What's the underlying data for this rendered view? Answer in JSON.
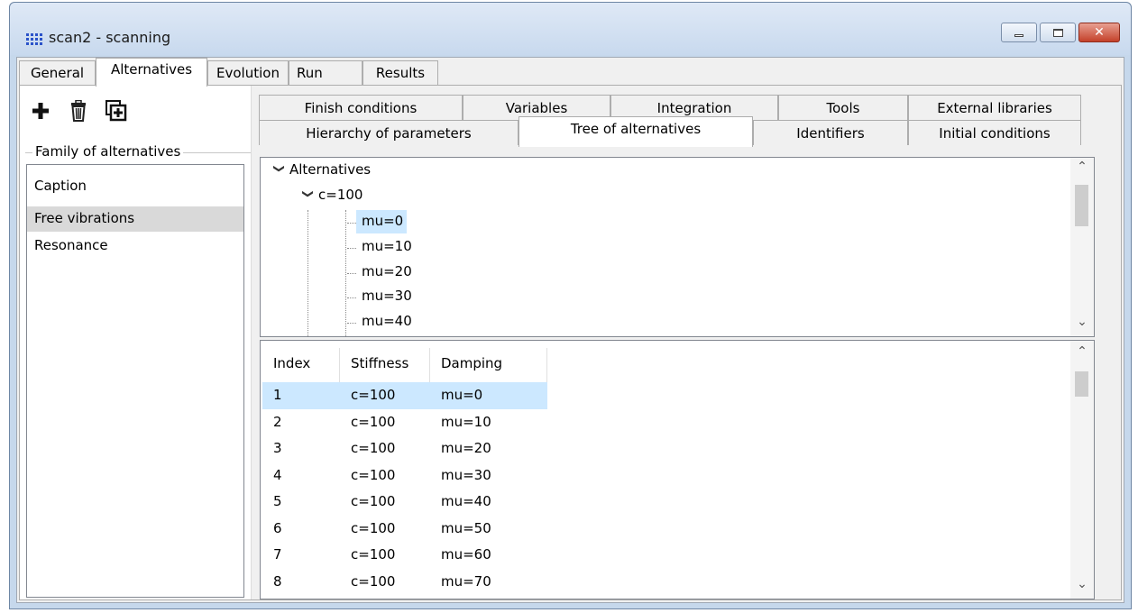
{
  "window": {
    "title": "scan2 - scanning",
    "close_glyph": "✕"
  },
  "main_tabs": [
    "General",
    "Alternatives",
    "Evolution",
    "Run",
    "Results"
  ],
  "family": {
    "label": "Family of alternatives",
    "items": [
      "Caption",
      "Free vibrations",
      "Resonance"
    ]
  },
  "sub_tabs_row1": [
    "Finish conditions",
    "Variables",
    "Integration",
    "Tools",
    "External libraries"
  ],
  "sub_tabs_row2": [
    "Hierarchy of parameters",
    "Tree of alternatives",
    "Identifiers",
    "Initial conditions"
  ],
  "tree": {
    "root": "Alternatives",
    "child": "c=100",
    "leaves": [
      "mu=0",
      "mu=10",
      "mu=20",
      "mu=30",
      "mu=40"
    ]
  },
  "table": {
    "headers": [
      "Index",
      "Stiffness",
      "Damping"
    ],
    "rows": [
      [
        "1",
        "c=100",
        "mu=0"
      ],
      [
        "2",
        "c=100",
        "mu=10"
      ],
      [
        "3",
        "c=100",
        "mu=20"
      ],
      [
        "4",
        "c=100",
        "mu=30"
      ],
      [
        "5",
        "c=100",
        "mu=40"
      ],
      [
        "6",
        "c=100",
        "mu=50"
      ],
      [
        "7",
        "c=100",
        "mu=60"
      ],
      [
        "8",
        "c=100",
        "mu=70"
      ]
    ]
  }
}
